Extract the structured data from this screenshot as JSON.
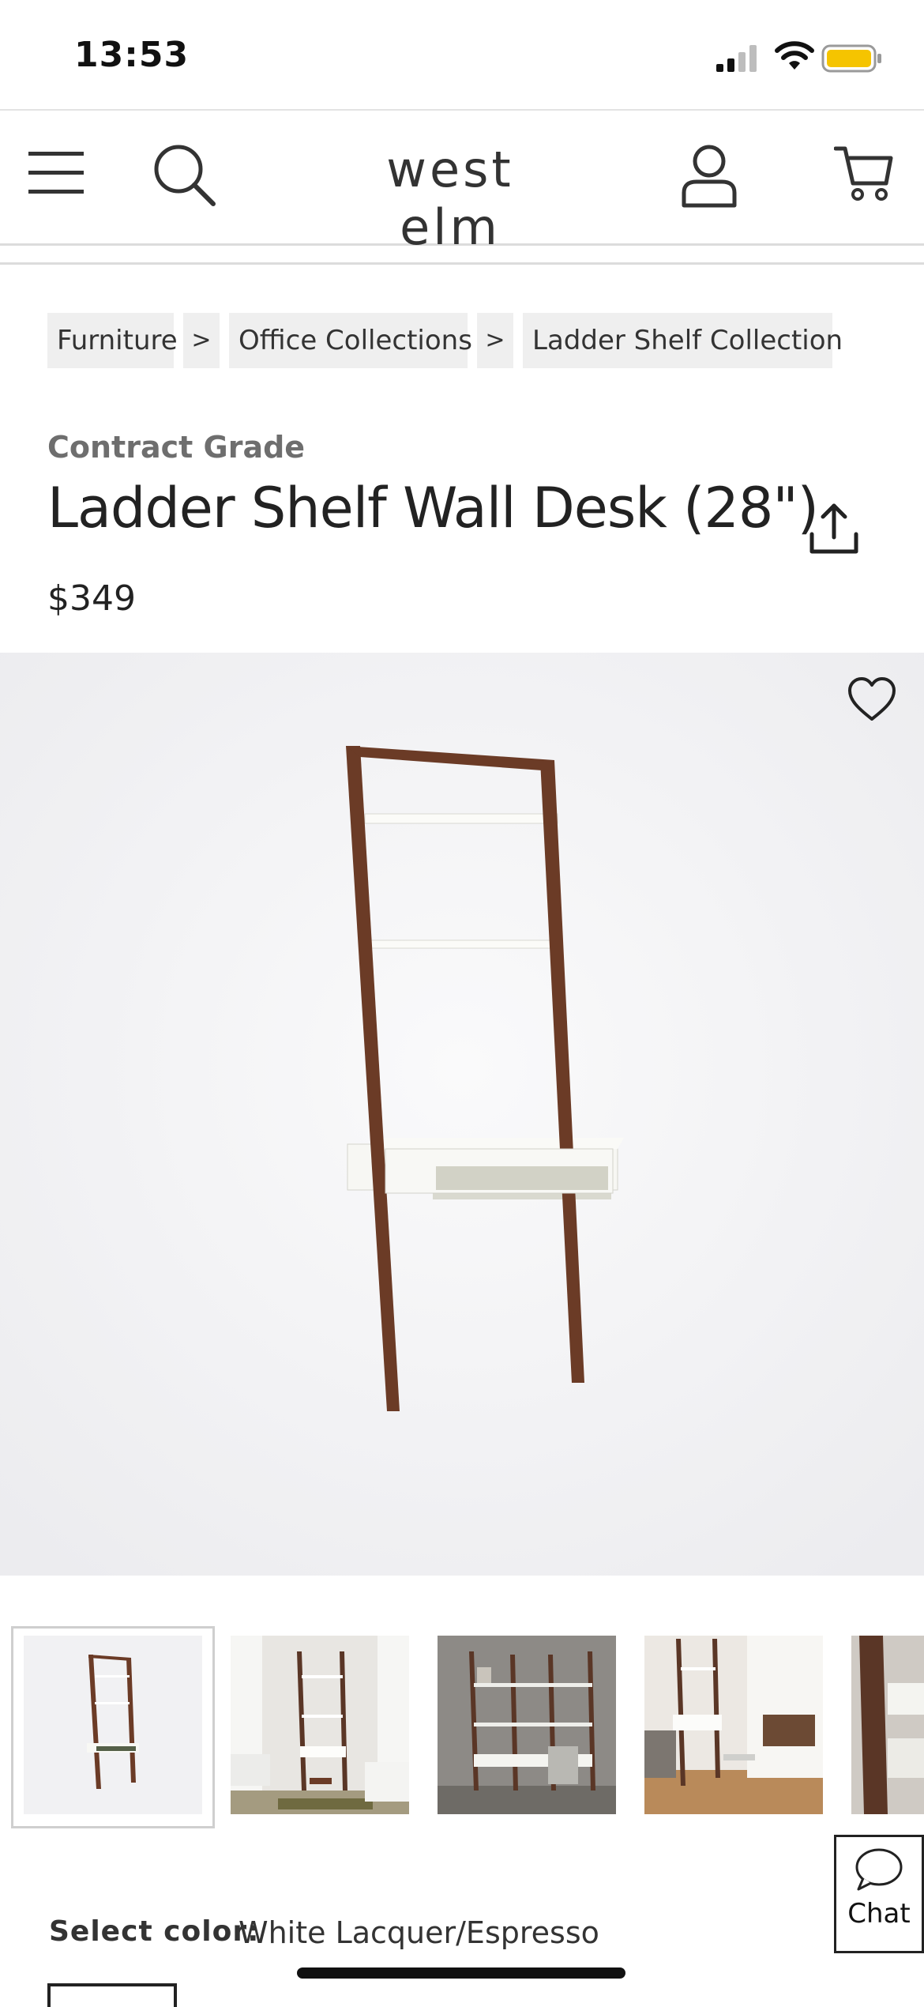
{
  "status_bar": {
    "time": "13:53"
  },
  "header": {
    "logo": "west elm"
  },
  "breadcrumb": {
    "items": [
      "Furniture",
      "Office Collections",
      "Ladder Shelf Collection"
    ],
    "separator": ">"
  },
  "product": {
    "eyebrow": "Contract Grade",
    "title": "Ladder Shelf Wall Desk (28\")",
    "price": "$349"
  },
  "gallery": {
    "thumbnail_count_visible": 5,
    "selected_index": 0
  },
  "chat": {
    "label": "Chat"
  },
  "color_select": {
    "label": "Select color:",
    "value": "White Lacquer/Espresso"
  },
  "colors": {
    "battery": "#f5c400",
    "wood": "#6b3b26",
    "lacquer": "#f4f4f0",
    "hero_bg": "#f2f2f4"
  },
  "icons": [
    "menu-icon",
    "search-icon",
    "account-icon",
    "cart-icon",
    "share-icon",
    "heart-icon",
    "chat-bubble-icon"
  ]
}
